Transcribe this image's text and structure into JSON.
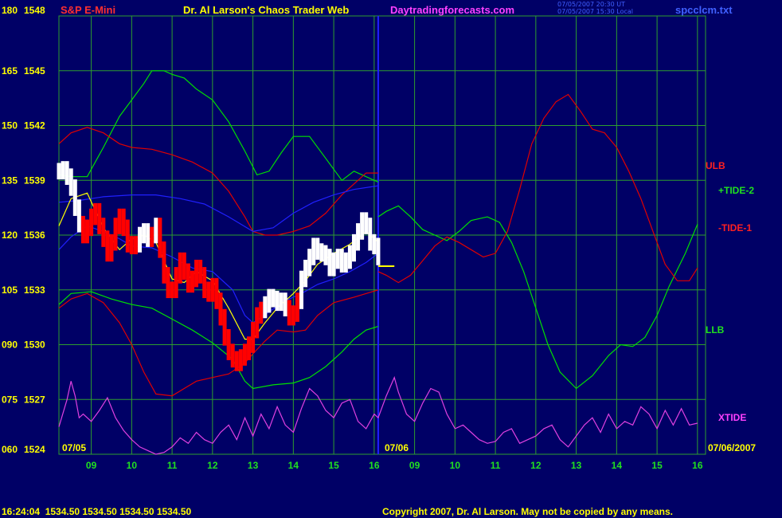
{
  "header": {
    "instrument": "S&P E-Mini",
    "title": "Dr. Al Larson's Chaos Trader Web",
    "site": "Daytradingforecasts.com",
    "timestamp_1": "07/05/2007 20:30 UT",
    "timestamp_2": "07/05/2007 15:30 Local",
    "source_file": "spcclcm.txt"
  },
  "footer": {
    "quote": "16:24:04  1534.50 1534.50 1534.50 1534.50",
    "copyright": "Copyright 2007, Dr. Al Larson. May not be copied by any means."
  },
  "colors": {
    "background": "#000066",
    "grid": "#2e9e2e",
    "green_line": "#00e000",
    "red_line": "#e00000",
    "blue_line": "#2020ff",
    "xtide": "#e040e0",
    "price_up": "#ffffff",
    "price_down": "#ff0000",
    "yellow": "#ffff00"
  },
  "chart_data": {
    "type": "line",
    "y_axis": {
      "left_labels": [
        "060",
        "075",
        "090",
        "105",
        "120",
        "135",
        "150",
        "165",
        "180"
      ],
      "price_labels": [
        "1524",
        "1527",
        "1530",
        "1533",
        "1536",
        "1539",
        "1542",
        "1545",
        "1548"
      ],
      "ylim": [
        1524,
        1548
      ]
    },
    "x_axis": {
      "day1_labels": [
        "09",
        "10",
        "11",
        "12",
        "13",
        "14",
        "15",
        "16"
      ],
      "day2_labels": [
        "09",
        "10",
        "11",
        "12",
        "13",
        "14",
        "15",
        "16"
      ],
      "date_markers": [
        "07/05",
        "07/06",
        "07/06/2007"
      ]
    },
    "right_labels": {
      "ulb": "ULB",
      "tide2": "+TIDE-2",
      "tide1": "-TIDE-1",
      "llb": "LLB",
      "xtide": "XTIDE"
    },
    "grid": true,
    "series": [
      {
        "key": "upper_green_band",
        "x": [
          8.2,
          8.5,
          8.9,
          9.3,
          9.7,
          10.0,
          10.3,
          10.5,
          10.8,
          11.0,
          11.3,
          11.6,
          12.0,
          12.4,
          12.8,
          13.1,
          13.4,
          13.7,
          14.0,
          14.4,
          14.8,
          15.2,
          15.5,
          15.8,
          16.1
        ],
        "y": [
          1539.3,
          1539.2,
          1539.2,
          1540.8,
          1542.5,
          1543.4,
          1544.3,
          1545.0,
          1545.0,
          1544.8,
          1544.6,
          1544.0,
          1543.4,
          1542.2,
          1540.6,
          1539.3,
          1539.5,
          1540.5,
          1541.4,
          1541.4,
          1540.2,
          1539.0,
          1539.5,
          1539.2,
          1538.9
        ]
      },
      {
        "key": "ulb_red",
        "x": [
          8.2,
          8.5,
          8.9,
          9.3,
          9.7,
          10.0,
          10.5,
          11.0,
          11.5,
          12.0,
          12.4,
          12.8,
          13.0,
          13.3,
          13.6,
          14.0,
          14.4,
          14.8,
          15.2,
          15.5,
          15.8,
          16.1
        ],
        "y": [
          1541.0,
          1541.6,
          1541.9,
          1541.6,
          1541.0,
          1540.8,
          1540.7,
          1540.4,
          1540.0,
          1539.4,
          1538.4,
          1537.0,
          1536.2,
          1536.0,
          1536.0,
          1536.2,
          1536.5,
          1537.2,
          1538.2,
          1538.8,
          1539.4,
          1539.4
        ]
      },
      {
        "key": "upper_blue_band",
        "x": [
          8.2,
          8.7,
          9.3,
          10.0,
          10.6,
          11.2,
          11.8,
          12.4,
          13.0,
          13.5,
          14.0,
          14.5,
          15.0,
          15.5,
          16.1
        ],
        "y": [
          1537.8,
          1537.9,
          1538.1,
          1538.2,
          1538.2,
          1538.0,
          1537.7,
          1537.0,
          1536.2,
          1536.4,
          1537.2,
          1537.8,
          1538.2,
          1538.5,
          1538.7
        ]
      },
      {
        "key": "lower_green_band",
        "x": [
          8.2,
          8.5,
          9.0,
          9.5,
          10.0,
          10.5,
          11.0,
          11.5,
          12.0,
          12.5,
          12.8,
          13.0,
          13.5,
          14.0,
          14.4,
          14.8,
          15.2,
          15.5,
          15.8,
          16.1
        ],
        "y": [
          1532.2,
          1532.8,
          1532.9,
          1532.5,
          1532.2,
          1532.0,
          1531.4,
          1530.8,
          1530.1,
          1529.2,
          1528.0,
          1527.6,
          1527.8,
          1527.9,
          1528.2,
          1528.8,
          1529.6,
          1530.3,
          1530.8,
          1531.0
        ]
      },
      {
        "key": "lower_red_band",
        "x": [
          8.2,
          8.5,
          8.9,
          9.3,
          9.7,
          10.0,
          10.3,
          10.6,
          11.0,
          11.3,
          11.6,
          12.0,
          12.4,
          12.8,
          13.0,
          13.3,
          13.6,
          14.0,
          14.3,
          14.6,
          15.0,
          15.5,
          16.1
        ],
        "y": [
          1532.0,
          1532.5,
          1532.8,
          1532.3,
          1531.2,
          1530.0,
          1528.5,
          1527.3,
          1527.2,
          1527.6,
          1528.0,
          1528.2,
          1528.4,
          1529.0,
          1529.5,
          1530.2,
          1530.8,
          1530.7,
          1530.8,
          1531.6,
          1532.3,
          1532.6,
          1533.0
        ]
      },
      {
        "key": "blue_ma",
        "x": [
          8.2,
          8.5,
          8.9,
          9.3,
          9.7,
          10.0,
          10.5,
          11.0,
          11.5,
          12.0,
          12.5,
          12.8,
          13.0,
          13.4,
          13.8,
          14.2,
          14.6,
          15.0,
          15.4,
          15.8,
          16.1
        ],
        "y": [
          1535.2,
          1535.9,
          1536.5,
          1536.2,
          1535.8,
          1535.4,
          1535.3,
          1534.8,
          1534.2,
          1534.0,
          1533.0,
          1531.6,
          1531.2,
          1531.8,
          1532.4,
          1532.8,
          1533.3,
          1533.6,
          1534.0,
          1534.5,
          1535.0
        ]
      },
      {
        "key": "yellow_ma",
        "x": [
          8.2,
          8.5,
          8.9,
          9.3,
          9.7,
          10.0,
          10.3,
          10.6,
          11.0,
          11.3,
          11.6,
          12.0,
          12.4,
          12.8,
          13.0,
          13.3,
          13.6,
          14.0,
          14.3,
          14.6,
          15.0,
          15.4,
          15.8,
          16.1
        ],
        "y": [
          1536.5,
          1538.0,
          1538.3,
          1536.4,
          1535.2,
          1535.8,
          1536.0,
          1535.6,
          1533.6,
          1533.4,
          1534.0,
          1533.5,
          1532.0,
          1530.3,
          1530.3,
          1531.2,
          1532.0,
          1532.8,
          1533.5,
          1534.4,
          1535.0,
          1535.5,
          1536.2,
          1535.6
        ]
      },
      {
        "key": "price_bars",
        "x": [
          8.2,
          8.3,
          8.4,
          8.5,
          8.6,
          8.7,
          8.8,
          8.9,
          9.0,
          9.1,
          9.2,
          9.3,
          9.4,
          9.5,
          9.6,
          9.7,
          9.8,
          9.9,
          10.0,
          10.1,
          10.2,
          10.3,
          10.4,
          10.5,
          10.6,
          10.7,
          10.8,
          10.9,
          11.0,
          11.1,
          11.2,
          11.3,
          11.4,
          11.5,
          11.6,
          11.7,
          11.8,
          11.9,
          12.0,
          12.1,
          12.2,
          12.3,
          12.4,
          12.5,
          12.6,
          12.7,
          12.8,
          12.9,
          13.0,
          13.1,
          13.2,
          13.3,
          13.4,
          13.5,
          13.6,
          13.7,
          13.8,
          13.9,
          14.0,
          14.1,
          14.2,
          14.3,
          14.4,
          14.5,
          14.6,
          14.7,
          14.8,
          14.9,
          15.0,
          15.1,
          15.2,
          15.3,
          15.4,
          15.5,
          15.6,
          15.7,
          15.8,
          15.9,
          16.0,
          16.1
        ],
        "y": [
          1539.5,
          1539.6,
          1539.2,
          1538.6,
          1537.5,
          1536.6,
          1536.0,
          1536.4,
          1537.0,
          1537.3,
          1536.5,
          1535.8,
          1535.0,
          1535.6,
          1536.5,
          1537.0,
          1536.4,
          1535.5,
          1535.4,
          1535.5,
          1536.0,
          1536.2,
          1535.8,
          1536.0,
          1536.5,
          1535.2,
          1533.8,
          1533.0,
          1533.0,
          1533.8,
          1534.6,
          1534.0,
          1533.3,
          1533.6,
          1534.2,
          1533.8,
          1533.0,
          1532.8,
          1533.2,
          1532.4,
          1531.5,
          1530.4,
          1529.6,
          1529.2,
          1529.0,
          1529.3,
          1529.6,
          1530.0,
          1530.8,
          1531.6,
          1531.9,
          1532.2,
          1532.6,
          1532.5,
          1532.3,
          1532.4,
          1532.0,
          1531.5,
          1531.7,
          1532.4,
          1533.6,
          1534.2,
          1534.8,
          1535.4,
          1535.1,
          1535.0,
          1534.8,
          1534.2,
          1534.6,
          1534.8,
          1534.4,
          1534.6,
          1535.0,
          1535.6,
          1536.2,
          1536.8,
          1536.5,
          1535.6,
          1535.4,
          1534.8
        ],
        "colors": [
          "u",
          "u",
          "u",
          "u",
          "u",
          "u",
          "d",
          "d",
          "d",
          "d",
          "d",
          "d",
          "d",
          "d",
          "d",
          "d",
          "d",
          "d",
          "d",
          "d",
          "u",
          "u",
          "u",
          "d",
          "u",
          "d",
          "d",
          "d",
          "d",
          "d",
          "d",
          "d",
          "d",
          "d",
          "d",
          "d",
          "d",
          "d",
          "d",
          "d",
          "d",
          "d",
          "d",
          "d",
          "d",
          "d",
          "d",
          "d",
          "d",
          "d",
          "d",
          "u",
          "u",
          "u",
          "u",
          "u",
          "u",
          "d",
          "d",
          "d",
          "u",
          "u",
          "u",
          "u",
          "u",
          "u",
          "u",
          "u",
          "u",
          "u",
          "u",
          "u",
          "u",
          "u",
          "u",
          "u",
          "u",
          "u",
          "u",
          "u"
        ]
      },
      {
        "key": "tide2_green",
        "x": [
          16.1,
          16.3,
          16.6,
          16.9,
          17.2,
          17.5,
          17.8,
          18.1,
          18.4,
          18.8,
          19.1,
          19.4,
          19.7,
          20.0,
          20.3,
          20.6,
          21.0,
          21.4,
          21.8,
          22.1,
          22.4,
          22.7,
          23.0,
          23.3,
          23.7,
          24.0
        ],
        "y": [
          1537.0,
          1537.3,
          1537.6,
          1537.0,
          1536.3,
          1536.0,
          1535.7,
          1536.2,
          1536.8,
          1537.0,
          1536.7,
          1535.6,
          1534.0,
          1532.0,
          1530.0,
          1528.5,
          1527.6,
          1528.3,
          1529.4,
          1530.0,
          1529.9,
          1530.4,
          1531.6,
          1533.2,
          1535.0,
          1536.6
        ]
      },
      {
        "key": "tide1_red",
        "x": [
          16.1,
          16.3,
          16.6,
          16.9,
          17.2,
          17.5,
          17.8,
          18.1,
          18.4,
          18.7,
          19.0,
          19.3,
          19.6,
          19.9,
          20.2,
          20.5,
          20.8,
          21.1,
          21.4,
          21.7,
          22.0,
          22.3,
          22.6,
          22.9,
          23.2,
          23.5,
          23.8,
          24.0
        ],
        "y": [
          1534.0,
          1533.8,
          1533.4,
          1533.8,
          1534.6,
          1535.4,
          1535.9,
          1535.6,
          1535.2,
          1534.8,
          1535.0,
          1536.2,
          1538.5,
          1541.0,
          1542.4,
          1543.3,
          1543.7,
          1542.8,
          1541.8,
          1541.6,
          1540.8,
          1539.5,
          1538.0,
          1536.2,
          1534.4,
          1533.5,
          1533.5,
          1534.2
        ]
      },
      {
        "key": "xtide",
        "x": [
          8.2,
          8.4,
          8.5,
          8.6,
          8.7,
          8.8,
          9.0,
          9.2,
          9.4,
          9.6,
          9.8,
          10.0,
          10.2,
          10.4,
          10.6,
          10.8,
          11.0,
          11.2,
          11.4,
          11.6,
          11.8,
          12.0,
          12.2,
          12.4,
          12.6,
          12.8,
          13.0,
          13.2,
          13.4,
          13.6,
          13.8,
          14.0,
          14.2,
          14.4,
          14.6,
          14.8,
          15.0,
          15.2,
          15.4,
          15.6,
          15.8,
          16.0,
          16.1,
          16.3,
          16.5,
          16.6,
          16.8,
          17.0,
          17.2,
          17.4,
          17.6,
          17.8,
          18.0,
          18.2,
          18.4,
          18.6,
          18.8,
          19.0,
          19.2,
          19.4,
          19.6,
          19.8,
          20.0,
          20.2,
          20.4,
          20.6,
          20.8,
          21.0,
          21.2,
          21.4,
          21.6,
          21.8,
          22.0,
          22.2,
          22.4,
          22.6,
          22.8,
          23.0,
          23.2,
          23.4,
          23.6,
          23.8,
          24.0
        ],
        "y": [
          1525.5,
          1527.0,
          1528.0,
          1527.2,
          1526.0,
          1526.2,
          1525.8,
          1526.4,
          1527.1,
          1526.0,
          1525.3,
          1524.8,
          1524.4,
          1524.2,
          1524.0,
          1524.1,
          1524.4,
          1524.9,
          1524.6,
          1525.2,
          1524.8,
          1524.6,
          1525.2,
          1525.6,
          1524.8,
          1526.0,
          1525.0,
          1526.2,
          1525.4,
          1526.6,
          1525.6,
          1525.2,
          1526.5,
          1527.6,
          1527.2,
          1526.4,
          1526.0,
          1526.8,
          1527.0,
          1525.8,
          1525.4,
          1526.2,
          1526.0,
          1527.2,
          1528.2,
          1527.4,
          1526.2,
          1525.8,
          1526.8,
          1527.6,
          1527.4,
          1526.2,
          1525.4,
          1525.6,
          1525.2,
          1524.8,
          1524.6,
          1524.7,
          1525.2,
          1525.4,
          1524.6,
          1524.8,
          1525.0,
          1525.4,
          1525.6,
          1524.8,
          1524.4,
          1525.0,
          1525.6,
          1526.0,
          1525.2,
          1526.2,
          1525.4,
          1525.8,
          1525.6,
          1526.6,
          1526.2,
          1525.4,
          1526.4,
          1525.6,
          1526.5,
          1525.6,
          1525.7
        ]
      }
    ],
    "last_price_marker": {
      "x": [
        16.1,
        16.5
      ],
      "y": 1534.3
    }
  }
}
